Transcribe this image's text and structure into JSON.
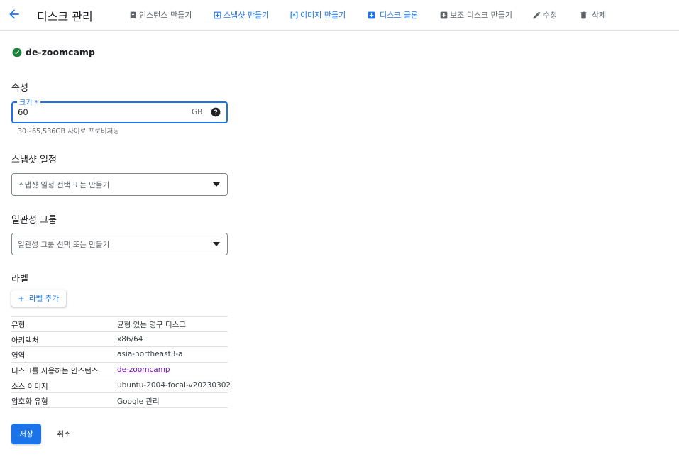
{
  "header": {
    "title": "디스크 관리",
    "actions": [
      {
        "label": "인스턴스 만들기",
        "icon": "bookmark-plus-icon"
      },
      {
        "label": "스냅샷 만들기",
        "icon": "snapshot-add-icon"
      },
      {
        "label": "이미지 만들기",
        "icon": "image-create-icon"
      },
      {
        "label": "디스크 클론",
        "icon": "disk-clone-icon"
      },
      {
        "label": "보조 디스크 만들기",
        "icon": "secondary-disk-icon"
      },
      {
        "label": "수정",
        "icon": "pencil-icon"
      },
      {
        "label": "삭제",
        "icon": "trash-icon"
      }
    ]
  },
  "disk": {
    "name": "de-zoomcamp",
    "status": "ok"
  },
  "properties": {
    "title": "속성",
    "size_label": "크기 *",
    "size_value": "60",
    "size_unit": "GB",
    "size_hint": "30~65,536GB 사이로 프로비저닝"
  },
  "snapshot_schedule": {
    "title": "스냅샷 일정",
    "placeholder": "스냅샷 일정 선택 또는 만들기"
  },
  "consistency_group": {
    "title": "일관성 그룹",
    "placeholder": "일관성 그룹 선택 또는 만들기"
  },
  "labels": {
    "title": "라벨",
    "add_button": "라벨 추가"
  },
  "info": [
    {
      "key": "유형",
      "value": "균형 있는 영구 디스크"
    },
    {
      "key": "아키텍처",
      "value": "x86/64"
    },
    {
      "key": "영역",
      "value": "asia-northeast3-a"
    },
    {
      "key": "디스크를 사용하는 인스턴스",
      "value": "de-zoomcamp"
    },
    {
      "key": "소스 이미지",
      "value": "ubuntu-2004-focal-v20230302"
    },
    {
      "key": "암호화 유형",
      "value": "Google 관리"
    }
  ],
  "buttons": {
    "save": "저장",
    "cancel": "취소"
  },
  "colors": {
    "accent": "#1a73e8",
    "link_visited": "#681da8",
    "success": "#188038"
  }
}
